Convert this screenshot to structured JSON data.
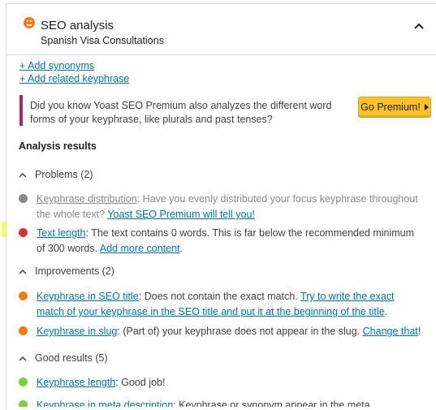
{
  "header": {
    "title": "SEO analysis",
    "subtitle": "Spanish Visa Consultations"
  },
  "links": {
    "add_synonyms": "+ Add synonyms",
    "add_related": "+ Add related keyphrase"
  },
  "upsell": {
    "text": "Did you know Yoast SEO Premium also analyzes the different word forms of your keyphrase, like plurals and past tenses?",
    "button": "Go Premium!"
  },
  "analysis_heading": "Analysis results",
  "sections": {
    "problems": "Problems (2)",
    "improvements": "Improvements (2)",
    "good": "Good results (5)"
  },
  "items": {
    "kd_link": "Keyphrase distribution",
    "kd_text": ": Have you evenly distributed your focus keyphrase throughout the whole text? ",
    "kd_cta": "Yoast SEO Premium will tell you!",
    "tl_link": "Text length",
    "tl_text": ": The text contains 0 words. This is far below the recommended minimum of 300 words. ",
    "tl_cta": "Add more content",
    "tl_end": ".",
    "st_link": "Keyphrase in SEO title",
    "st_text": ": Does not contain the exact match. ",
    "st_cta": "Try to write the exact match of your keyphrase in the SEO title and put it at the beginning of the title",
    "st_end": ".",
    "sl_link": "Keyphrase in slug",
    "sl_text": ": (Part of) your keyphrase does not appear in the slug. ",
    "sl_cta": "Change that",
    "sl_end": "!",
    "kl_link": "Keyphrase length",
    "kl_text": ": Good job!",
    "md_link": "Keyphrase in meta description",
    "md_text": ": Keyphrase or synonym appear in the meta description. Well done!"
  },
  "colors": {
    "grey": "#8a8a8a",
    "red": "#dc3232",
    "orange": "#ee7c1b",
    "green": "#7ad03a",
    "link": "#0073aa",
    "highlight": "#ffff3e",
    "premium": "#fec228"
  },
  "icons": {
    "score": "orange-smiley-icon",
    "collapse": "chevron-up-icon",
    "section": "caret-up-icon"
  }
}
